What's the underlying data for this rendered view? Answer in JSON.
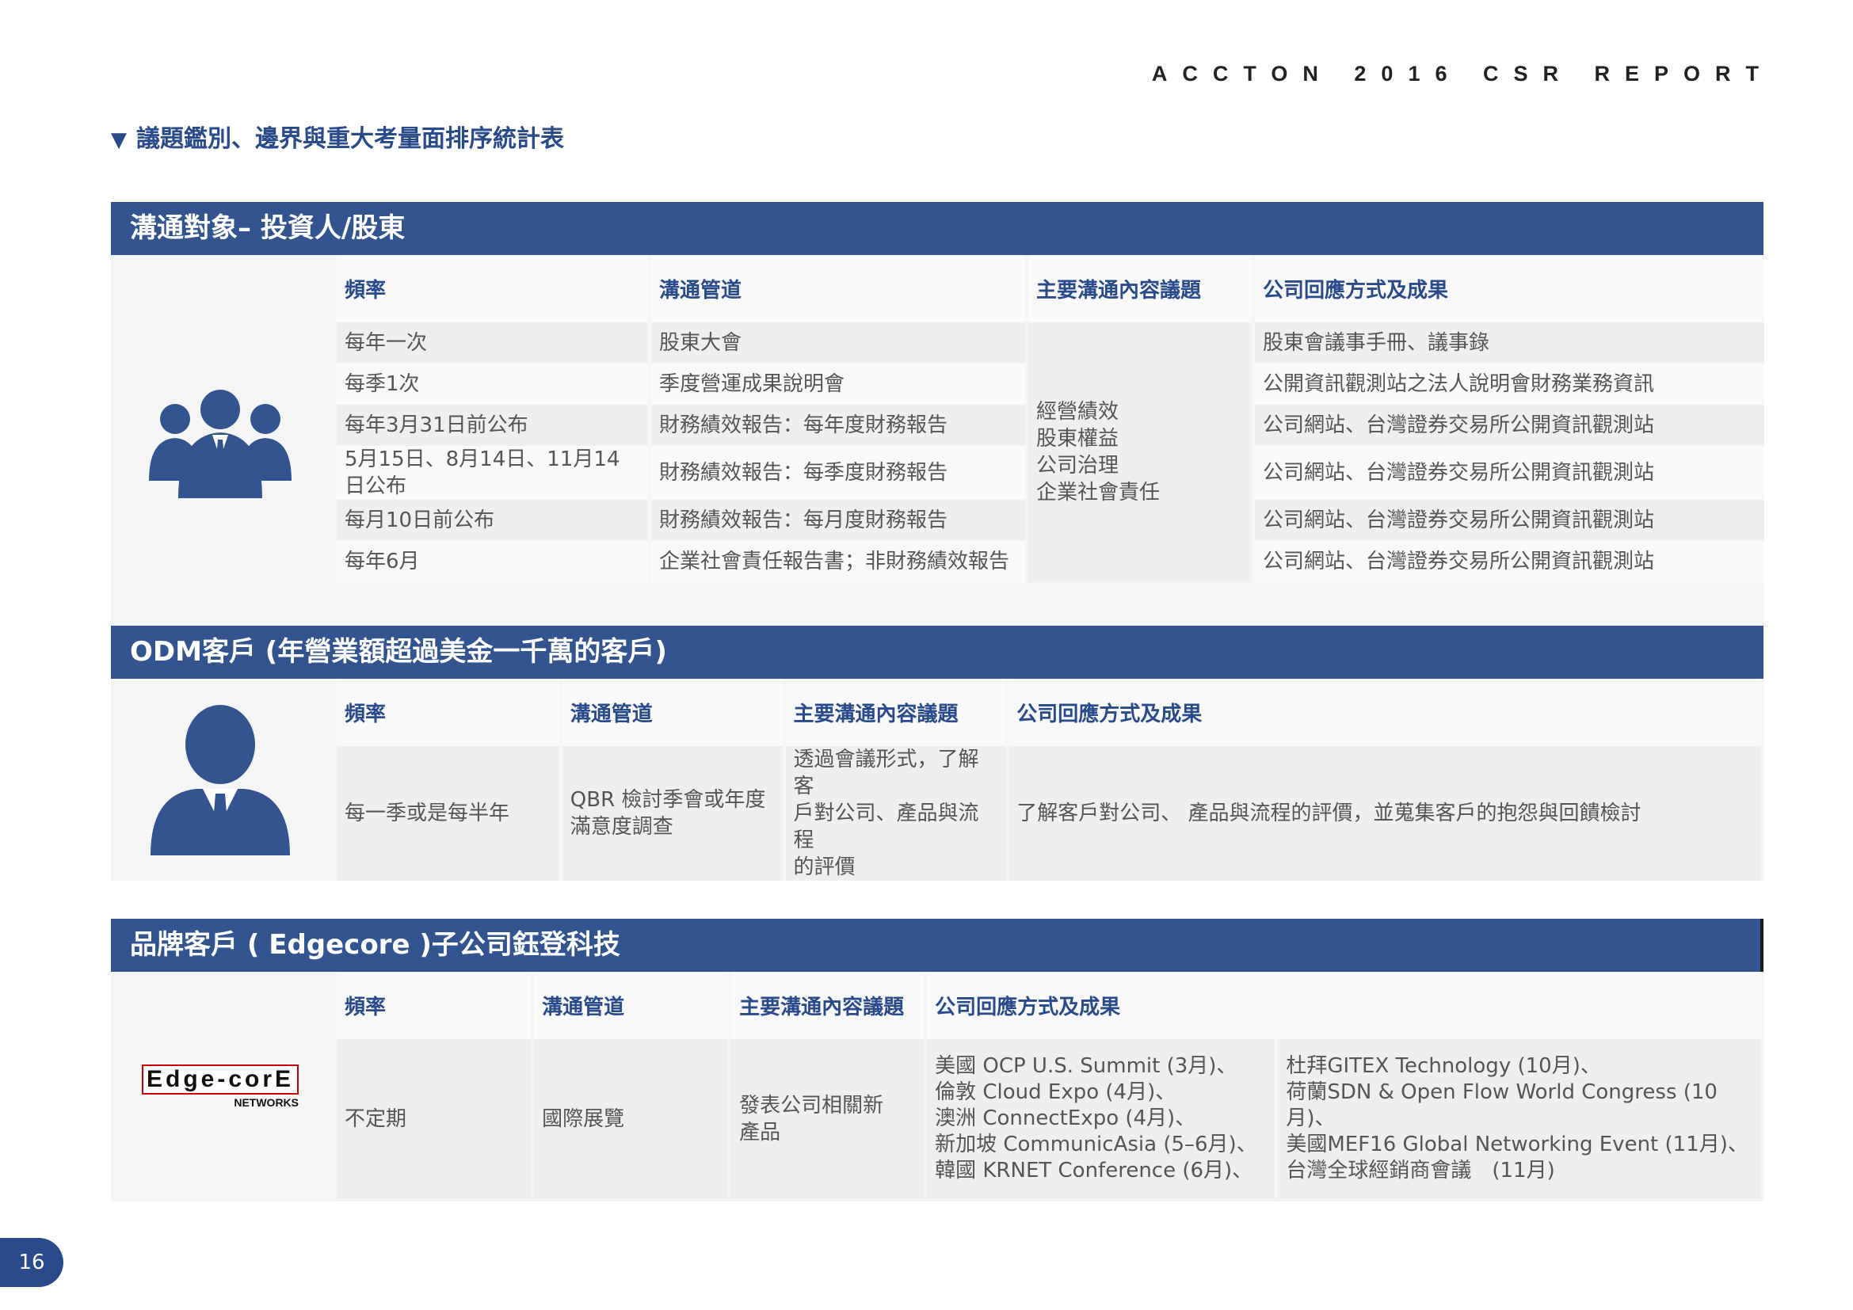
{
  "header": {
    "report_title": "ACCTON 2016 CSR REPORT"
  },
  "page_title": "議題鑑別、邊界與重大考量面排序統計表",
  "page_number": "16",
  "columns": {
    "freq": "頻率",
    "channel": "溝通管道",
    "topics": "主要溝通內容議題",
    "response": "公司回應方式及成果"
  },
  "sections": [
    {
      "title": "溝通對象– 投資人/股東",
      "icon": "group-of-people-icon",
      "rows": [
        {
          "freq": "每年一次",
          "channel": "股東大會",
          "response": "股東會議事手冊、議事錄"
        },
        {
          "freq": "每季1次",
          "channel": "季度營運成果說明會",
          "response": "公開資訊觀測站之法人說明會財務業務資訊"
        },
        {
          "freq": "每年3月31日前公布",
          "channel": "財務績效報告：每年度財務報告",
          "response": "公司網站、台灣證券交易所公開資訊觀測站"
        },
        {
          "freq": "5月15日、8月14日、11月14日公布",
          "channel": "財務績效報告：每季度財務報告",
          "response": "公司網站、台灣證券交易所公開資訊觀測站"
        },
        {
          "freq": "每月10日前公布",
          "channel": "財務績效報告：每月度財務報告",
          "response": "公司網站、台灣證券交易所公開資訊觀測站"
        },
        {
          "freq": "每年6月",
          "channel": "企業社會責任報告書；非財務績效報告",
          "response": "公司網站、台灣證券交易所公開資訊觀測站"
        }
      ],
      "topics": "經營績效\n股東權益\n公司治理\n企業社會責任"
    },
    {
      "title": "ODM客戶 (年營業額超過美金一千萬的客戶)",
      "icon": "businessman-icon",
      "freq": "每一季或是每半年",
      "channel": "QBR 檢討季會或年度\n滿意度調查",
      "topics": "透過會議形式，了解客\n戶對公司、產品與流程\n的評價",
      "response": "了解客戶對公司、 產品與流程的評價，並蒐集客戶的抱怨與回饋檢討"
    },
    {
      "title": "品牌客戶 ( Edgecore )子公司鈺登科技",
      "icon": "edgecore-logo",
      "logo_text": "Edge-corE",
      "logo_sub": "NETWORKS",
      "freq": "不定期",
      "channel": "國際展覽",
      "topics": "發表公司相關新\n產品",
      "response_a": "美國 OCP U.S. Summit (3月)、\n倫敦 Cloud Expo (4月)、\n澳洲 ConnectExpo (4月)、\n新加坡 CommunicAsia (5–6月)、\n韓國 KRNET Conference (6月)、",
      "response_b": "杜拜GITEX Technology (10月)、\n荷蘭SDN & Open Flow World Congress (10月)、\n美國MEF16 Global Networking Event (11月)、\n台灣全球經銷商會議　(11月)"
    }
  ]
}
